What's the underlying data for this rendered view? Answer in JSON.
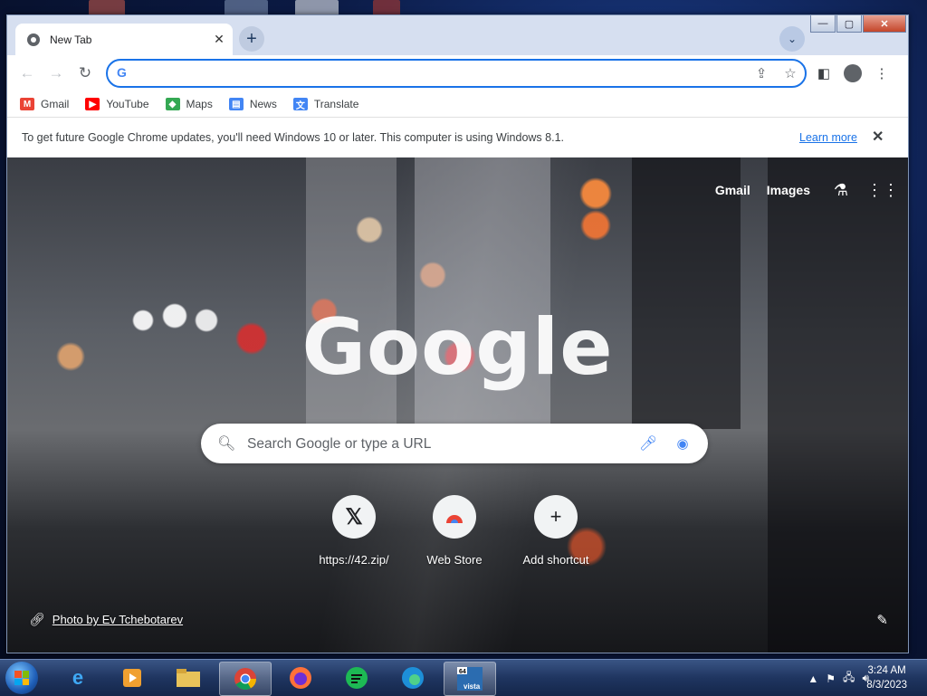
{
  "tab": {
    "title": "New Tab"
  },
  "omnibox": {
    "value": "",
    "placeholder": ""
  },
  "bookmarks": [
    {
      "label": "Gmail",
      "color": "#ea4335"
    },
    {
      "label": "YouTube",
      "color": "#ff0000"
    },
    {
      "label": "Maps",
      "color": "#34a853"
    },
    {
      "label": "News",
      "color": "#4285f4"
    },
    {
      "label": "Translate",
      "color": "#4285f4"
    }
  ],
  "infobar": {
    "message": "To get future Google Chrome updates, you'll need Windows 10 or later. This computer is using Windows 8.1.",
    "learn_more": "Learn more"
  },
  "ntp": {
    "gmail_link": "Gmail",
    "images_link": "Images",
    "logo_text": "Google",
    "search_placeholder": "Search Google or type a URL",
    "shortcuts": [
      {
        "label": "https://42.zip/",
        "icon": "x-logo-icon"
      },
      {
        "label": "Web Store",
        "icon": "web-store-icon"
      },
      {
        "label": "Add shortcut",
        "icon": "plus-icon"
      }
    ],
    "photo_credit": "Photo by Ev Tchebotarev"
  },
  "taskbar": {
    "time": "3:24 AM",
    "date": "8/3/2023"
  },
  "colors": {
    "accent": "#1a73e8",
    "taskbar": "#1f3560"
  }
}
